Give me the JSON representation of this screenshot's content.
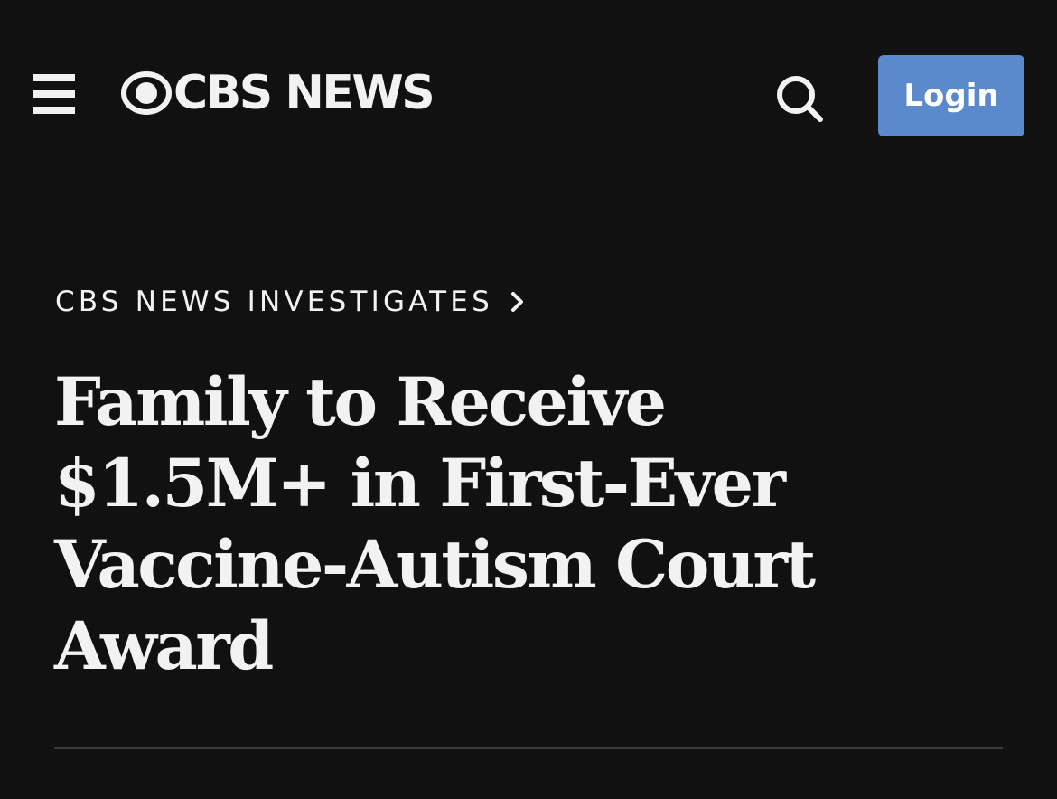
{
  "header": {
    "menu_icon": "hamburger-menu-icon",
    "logo_text": "CBS NEWS",
    "logo_icon": "cbs-eye-logo",
    "search_icon": "search-icon",
    "login_label": "Login",
    "login_color": "#5a8acb"
  },
  "article": {
    "section": "CBS NEWS INVESTIGATES",
    "section_icon": "chevron-right-icon",
    "headline_lines": [
      "Family to Receive",
      "$1.5M+ in First-Ever",
      "Vaccine-Autism Court",
      "Award"
    ]
  },
  "colors": {
    "background": "#111111",
    "text": "#f2f2f2",
    "accent": "#5a8acb"
  }
}
